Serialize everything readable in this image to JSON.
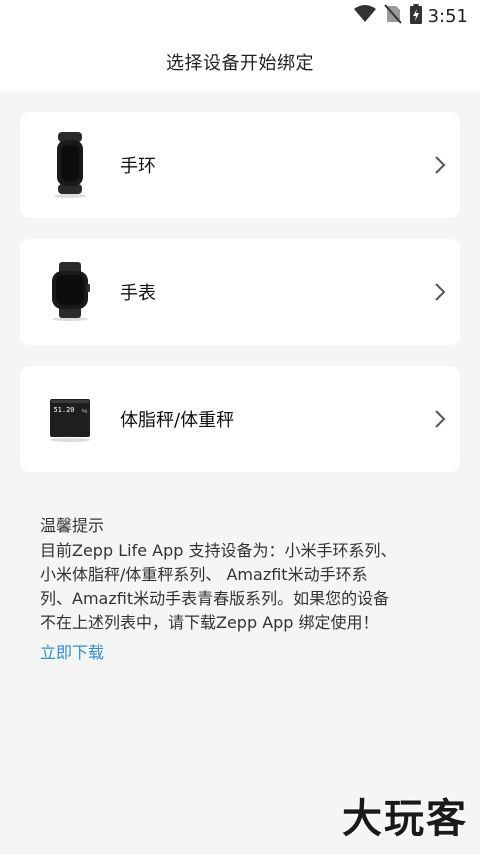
{
  "status_bar": {
    "time": "3:51",
    "icons": [
      "wifi-icon",
      "no-sim-icon",
      "battery-charging-icon"
    ]
  },
  "header": {
    "title": "选择设备开始绑定"
  },
  "devices": [
    {
      "label": "手环",
      "icon": "band-icon"
    },
    {
      "label": "手表",
      "icon": "watch-icon"
    },
    {
      "label": "体脂秤/体重秤",
      "icon": "scale-icon",
      "scale_reading": "51.20"
    }
  ],
  "tips": {
    "title": "温馨提示",
    "lines": [
      "目前Zepp Life App 支持设备为：小米手环系列、",
      "小米体脂秤/体重秤系列、 Amazfit米动手环系",
      "列、Amazfit米动手表青春版系列。如果您的设备",
      "不在上述列表中，请下载Zepp App 绑定使用！"
    ],
    "link": "立即下载"
  },
  "watermark": "大玩客",
  "colors": {
    "background": "#f5f5f5",
    "card": "#ffffff",
    "link": "#2f8fd8"
  }
}
